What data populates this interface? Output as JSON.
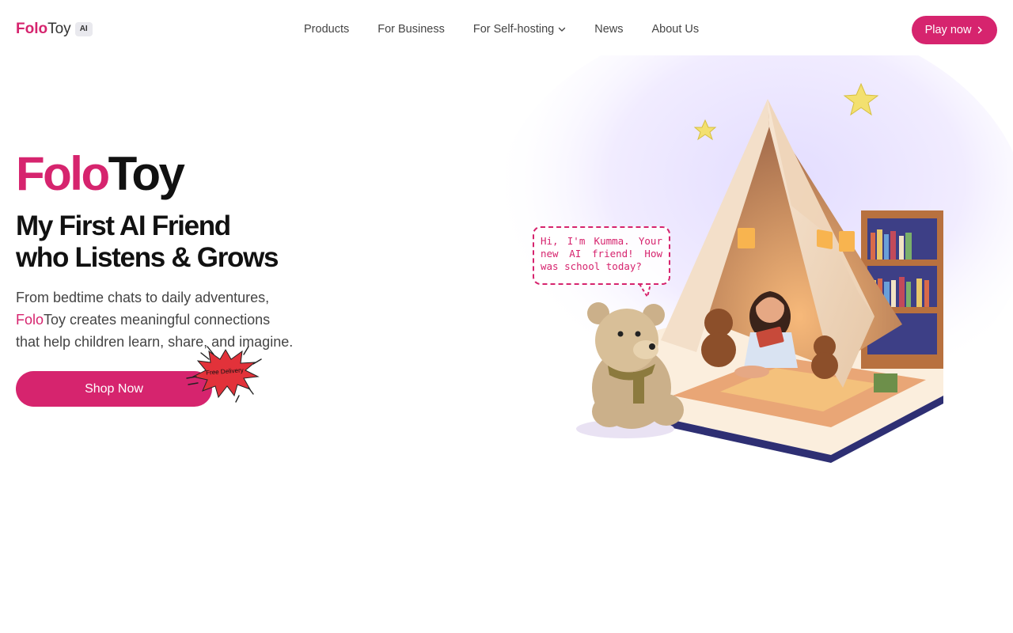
{
  "header": {
    "logo": {
      "part1": "Folo",
      "part2": "Toy",
      "badge": "AI"
    },
    "nav": [
      {
        "label": "Products"
      },
      {
        "label": "For Business"
      },
      {
        "label": "For Self-hosting"
      },
      {
        "label": "News"
      },
      {
        "label": "About Us"
      }
    ],
    "cta": "Play now"
  },
  "hero": {
    "brand": {
      "part1": "Folo",
      "part2": "Toy"
    },
    "tagline": {
      "line1": "My First AI Friend",
      "line2": "who Listens & Grows"
    },
    "description": {
      "line1": "From bedtime chats to daily adventures,",
      "brand1": "Folo",
      "brand2": "Toy",
      "line2_rest": " creates meaningful connections",
      "line3": "that help children learn, share, and imagine."
    },
    "shop_button": "Shop Now",
    "badge": "Free Delivery"
  },
  "illustration": {
    "speech_bubble": "Hi, I'm Kumma. Your new AI friend! How was school today?"
  },
  "colors": {
    "brand": "#d6246e",
    "text": "#111111",
    "muted": "#444444"
  },
  "icons": [
    "chevron-down-icon",
    "chevron-right-icon",
    "star-icon"
  ]
}
